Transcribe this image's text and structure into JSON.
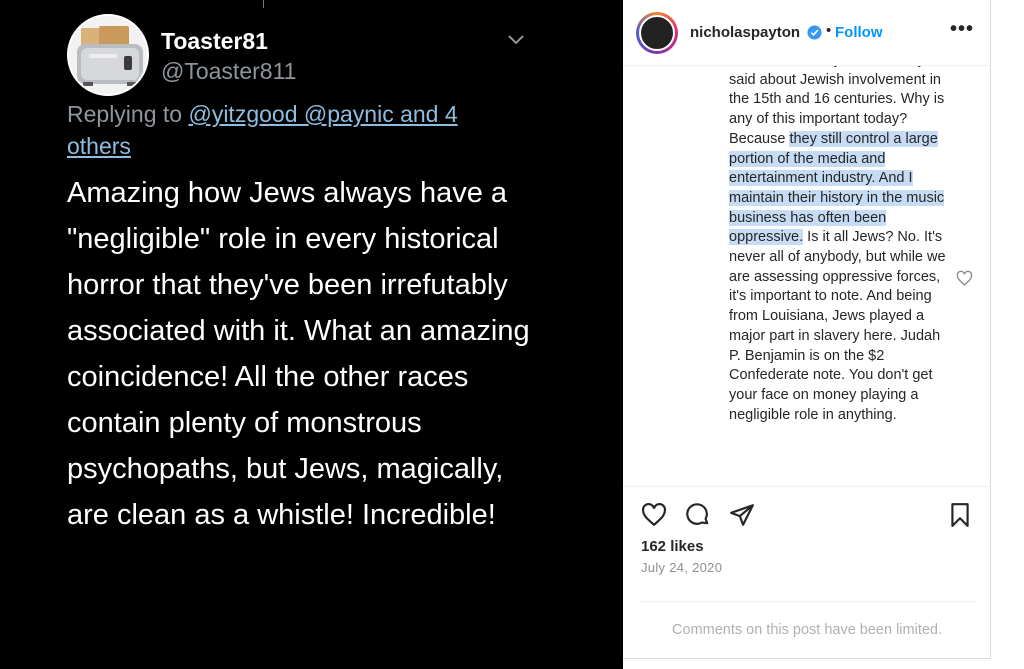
{
  "tweet": {
    "display_name": "Toaster81",
    "handle": "@Toaster811",
    "replying_prefix": "Replying to ",
    "replying_links": "@yitzgood @paynic and 4 others",
    "body": "Amazing how Jews always have a \"negligible\" role in every historical horror that they've been irrefutably associated with it. What an amazing coincidence! All the other races contain plenty of monstrous psychopaths, but Jews, magically, are clean as a whistle! Incredible!",
    "icons": {
      "avatar": "toaster-avatar",
      "menu": "chevron-down-icon"
    },
    "colors": {
      "background": "#000000",
      "link": "#8fbde0",
      "muted": "#8f959a"
    }
  },
  "instagram": {
    "username": "nicholaspayton",
    "dot": "•",
    "follow_label": "Follow",
    "more_label": "•••",
    "comment": {
      "clipped_line": "the video actually said. What",
      "before": "you said about Jewish involvement in the 15th and 16 centuries. Why is any of this important today? Because ",
      "highlighted": "they still control a large portion of the media and entertainment industry. And I maintain their history in the music business has often been oppressive.",
      "after": " Is it all Jews? No. It's never all of anybody, but while we are assessing oppressive forces, it's important to note. And being from Louisiana, Jews played a major part in slavery here. Judah P. Benjamin is on the $2 Confederate note. You don't get your face on money playing a negligible role in anything."
    },
    "likes": "162 likes",
    "date": "July 24, 2020",
    "comments_limited": "Comments on this post have been limited.",
    "icons": [
      "verified-badge-icon",
      "heart-icon",
      "comment-icon",
      "share-icon",
      "bookmark-icon",
      "more-options-icon"
    ],
    "colors": {
      "follow": "#0095f6",
      "highlight": "#c6dcf5"
    }
  }
}
